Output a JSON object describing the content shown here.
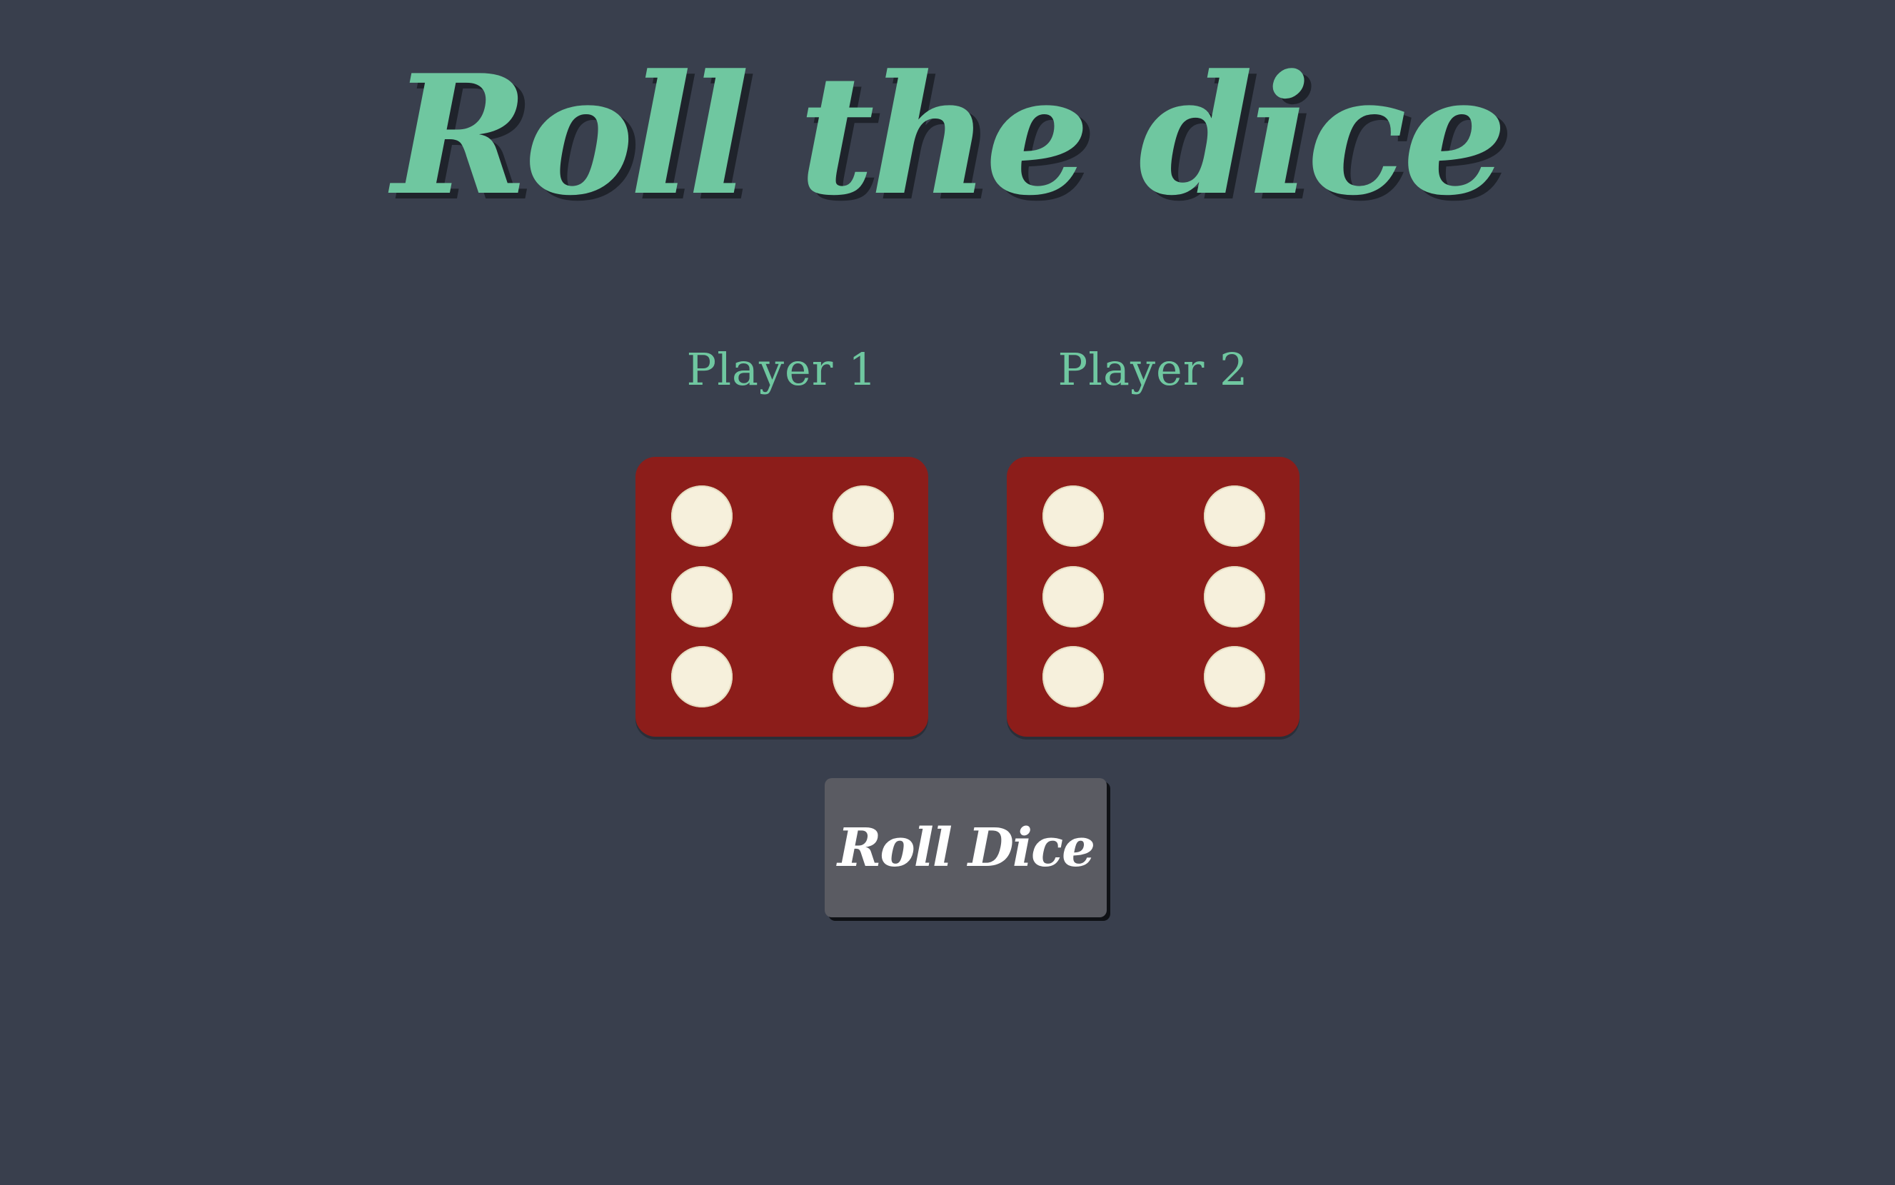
{
  "title": "Roll the dice",
  "players": [
    {
      "label": "Player 1",
      "die_value": 6
    },
    {
      "label": "Player 2",
      "die_value": 6
    }
  ],
  "roll_button_label": "Roll Dice",
  "colors": {
    "background": "#393f4d",
    "accent": "#6fc7a0",
    "die_face": "#8c1d1a",
    "pip": "#f6f0dc",
    "button": "#5a5b62",
    "button_text": "#ffffff"
  },
  "icons": [
    "die-six-icon",
    "die-six-icon"
  ]
}
